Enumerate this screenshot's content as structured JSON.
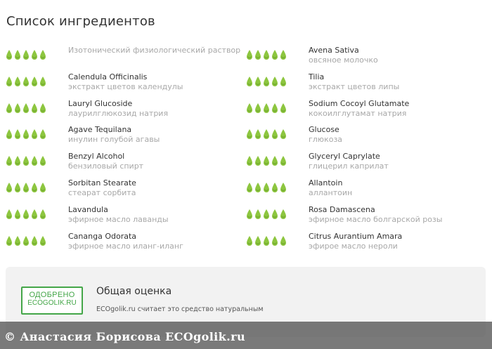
{
  "page": {
    "title": "Список ингредиентов"
  },
  "colors": {
    "rating_icon": "#8dc63f",
    "rating_icon_dark": "#6fa52e",
    "badge_green": "#44a648"
  },
  "rating_icon_name": "leaf-drop-icon",
  "ingredients": [
    {
      "name": "Изотонический физиологический раствор",
      "translation": "",
      "rating": 5
    },
    {
      "name": "Avena Sativa",
      "translation": "овсяное молочко",
      "rating": 5
    },
    {
      "name": "Calendula Officinalis",
      "translation": "экстракт цветов календулы",
      "rating": 5
    },
    {
      "name": "Tilia",
      "translation": "экстракт цветов липы",
      "rating": 5
    },
    {
      "name": "Lauryl Glucoside",
      "translation": "лаурилглюкозид натрия",
      "rating": 5
    },
    {
      "name": "Sodium Cocoyl Glutamate",
      "translation": "кокоилглутамат натрия",
      "rating": 5
    },
    {
      "name": "Agave Tequilana",
      "translation": "инулин голубой агавы",
      "rating": 5
    },
    {
      "name": "Glucose",
      "translation": "глюкоза",
      "rating": 5
    },
    {
      "name": "Benzyl Alcohol",
      "translation": "бензиловый спирт",
      "rating": 5
    },
    {
      "name": "Glyceryl Caprylate",
      "translation": "глицерил каприлат",
      "rating": 5
    },
    {
      "name": "Sorbitan Stearate",
      "translation": "стеарат сорбита",
      "rating": 5
    },
    {
      "name": "Allantoin",
      "translation": "аллантоин",
      "rating": 5
    },
    {
      "name": "Lavandula",
      "translation": "эфирное масло лаванды",
      "rating": 5
    },
    {
      "name": "Rosa Damascena",
      "translation": "эфирное масло болгарской розы",
      "rating": 5
    },
    {
      "name": "Cananga Odorata",
      "translation": "эфирное масло иланг-иланг",
      "rating": 5
    },
    {
      "name": "Citrus Aurantium Amara",
      "translation": "эфирое масло нероли",
      "rating": 5
    }
  ],
  "summary": {
    "badge_line1": "ОДОБРЕНО",
    "badge_line2": "ECOGOLIK.RU",
    "title": "Общая оценка",
    "text": "ECOgolik.ru считает это средство натуральным"
  },
  "watermark": {
    "text": "© Анастасия Борисова ECOgolik.ru"
  }
}
